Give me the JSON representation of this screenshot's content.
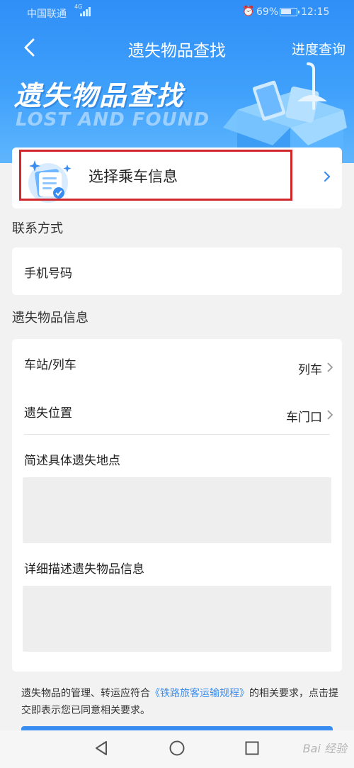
{
  "status_bar": {
    "carrier": "中国联通",
    "network": "4G",
    "battery": "69%",
    "time": "12:15"
  },
  "nav": {
    "title": "遗失物品查找",
    "progress_link": "进度查询"
  },
  "banner": {
    "title": "遗失物品查找",
    "subtitle": "LOST AND FOUND"
  },
  "select_trip": {
    "label": "选择乘车信息"
  },
  "contact": {
    "section_title": "联系方式",
    "phone_label": "手机号码",
    "phone_value": ""
  },
  "item_info": {
    "section_title": "遗失物品信息",
    "station_label": "车站/列车",
    "station_value": "列车",
    "location_label": "遗失位置",
    "location_value": "车门口",
    "place_label": "简述具体遗失地点",
    "place_value": "",
    "detail_label": "详细描述遗失物品信息",
    "detail_value": ""
  },
  "notice": {
    "prefix": "遗失物品的管理、转运应符合",
    "link": "《铁路旅客运输规程》",
    "suffix": "的相关要求，点击提交即表示您已同意相关要求。"
  },
  "watermark": "Bai 经验",
  "colors": {
    "header_blue": "#2f8ff7",
    "link_blue": "#3a8df0",
    "highlight_red": "#d0262c"
  }
}
